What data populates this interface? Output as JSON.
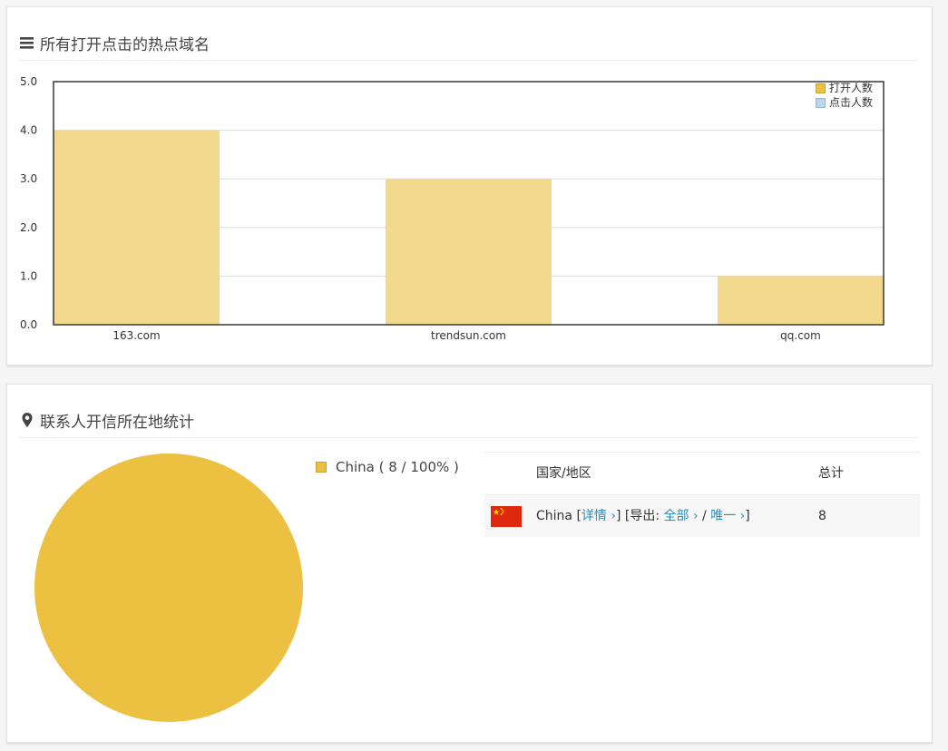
{
  "top_panel": {
    "title": "所有打开点击的热点域名",
    "icon": "bars-icon"
  },
  "bottom_panel": {
    "title": "联系人开信所在地统计",
    "icon": "map-marker-icon"
  },
  "chart_data": [
    {
      "type": "bar",
      "categories": [
        "163.com",
        "trendsun.com",
        "qq.com"
      ],
      "series": [
        {
          "name": "打开人数",
          "values": [
            4,
            3,
            1
          ],
          "color": "#f2d98e",
          "legend_color": "#f0c040"
        },
        {
          "name": "点击人数",
          "values": [
            0,
            0,
            0
          ],
          "color": "#b8d8f0",
          "legend_color": "#b8d8f0"
        }
      ],
      "ylim": [
        0,
        5
      ],
      "yticks": [
        "0.0",
        "1.0",
        "2.0",
        "3.0",
        "4.0",
        "5.0"
      ],
      "grid": true,
      "legend_position": "top-right"
    },
    {
      "type": "pie",
      "categories": [
        "China"
      ],
      "values": [
        8
      ],
      "colors": [
        "#ecc141"
      ],
      "legend_labels": [
        "China ( 8 / 100% )"
      ]
    }
  ],
  "geo_table": {
    "headers": {
      "country": "国家/地区",
      "total": "总计"
    },
    "rows": [
      {
        "flag_icon": "china-flag-icon",
        "country": "China",
        "detail_text": "详情 ›",
        "export_label": "导出:",
        "export_all": "全部 ›",
        "separator": "/",
        "export_unique": "唯一 ›",
        "total": "8"
      }
    ]
  },
  "colors": {
    "link": "#2a8fbd",
    "pie": "#ecc141",
    "bar": "#f2d98e"
  }
}
